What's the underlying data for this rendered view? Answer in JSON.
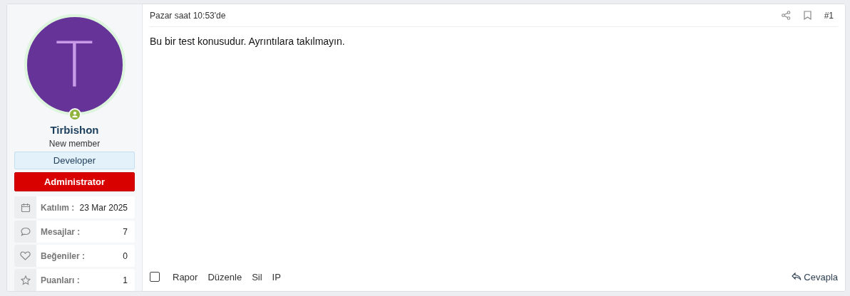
{
  "user": {
    "avatar_letter": "T",
    "online": true,
    "name": "Tirbishon",
    "title": "New member",
    "banners": [
      {
        "label": "Developer",
        "kind": "developer"
      },
      {
        "label": "Administrator",
        "kind": "admin"
      }
    ],
    "stats": [
      {
        "kind": "calendar",
        "label": "Katılım :",
        "value": "23 Mar 2025"
      },
      {
        "kind": "comment",
        "label": "Mesajlar :",
        "value": "7"
      },
      {
        "kind": "heart",
        "label": "Beğeniler :",
        "value": "0"
      },
      {
        "kind": "star",
        "label": "Puanları :",
        "value": "1"
      }
    ]
  },
  "post": {
    "time": "Pazar saat 10:53'de",
    "number": "#1",
    "message": "Bu bir test konusudur. Ayrıntılara takılmayın.",
    "checked": false,
    "actions": [
      "Rapor",
      "Düzenle",
      "Sil",
      "IP"
    ],
    "reply": "Cevapla"
  }
}
